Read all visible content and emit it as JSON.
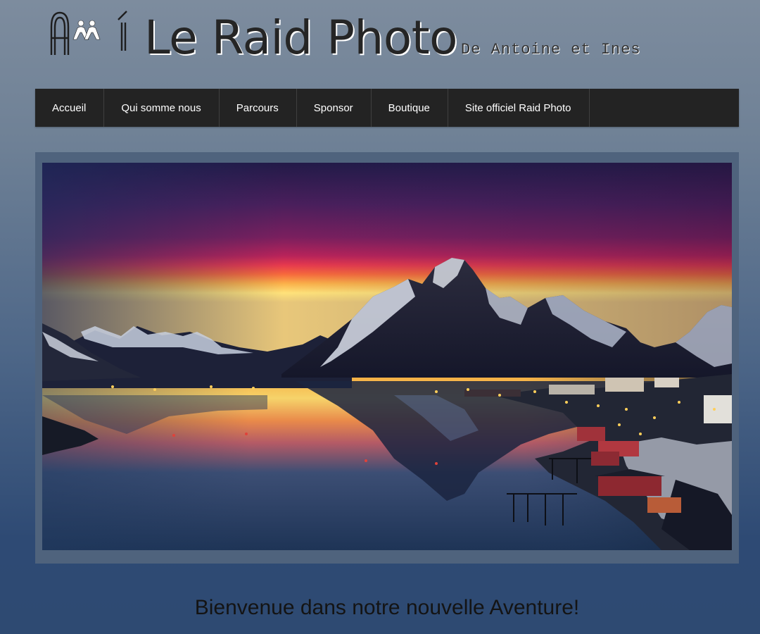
{
  "header": {
    "title": "Le Raid Photo",
    "tagline": "De Antoine et Ines"
  },
  "nav": {
    "items": [
      {
        "label": "Accueil"
      },
      {
        "label": "Qui somme nous"
      },
      {
        "label": "Parcours"
      },
      {
        "label": "Sponsor"
      },
      {
        "label": "Boutique"
      },
      {
        "label": "Site officiel Raid Photo"
      }
    ]
  },
  "main": {
    "welcome": "Bienvenue dans notre nouvelle Aventure!"
  },
  "colors": {
    "nav_bg": "#232323",
    "title": "#252525",
    "frame": "#4f637d"
  },
  "icons": {
    "logo": "kappa-logo-icon"
  }
}
